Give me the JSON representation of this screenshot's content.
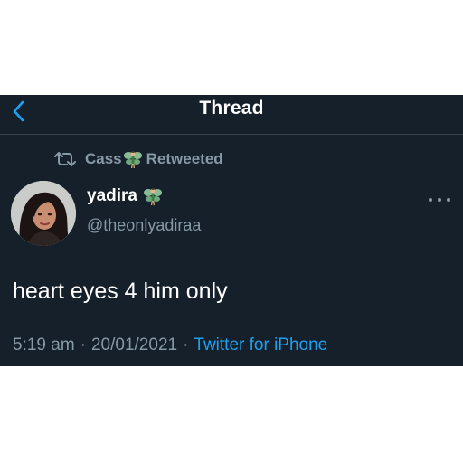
{
  "nav": {
    "title": "Thread",
    "back_icon": "chevron-left-icon"
  },
  "retweet": {
    "icon": "retweet-icon",
    "name": "Cass",
    "emoji_icon": "fairy-emoji-icon",
    "action": "Retweeted"
  },
  "tweet": {
    "author": {
      "display_name": "yadira",
      "emoji_icon": "fairy-emoji-icon",
      "handle": "@theonlyadiraa"
    },
    "text": "heart eyes 4 him only",
    "time": "5:19 am",
    "date": "20/01/2021",
    "separator": "·",
    "source": "Twitter for iPhone"
  },
  "colors": {
    "background": "#15202b",
    "divider": "#38444d",
    "secondary_text": "#8899a6",
    "accent": "#1da1f2",
    "primary_text": "#ffffff"
  }
}
